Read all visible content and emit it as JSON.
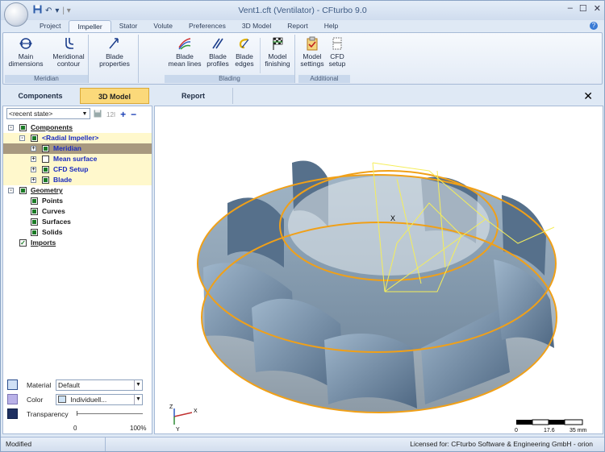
{
  "titlebar": {
    "title": "Vent1.cft (Ventilator) - CFturbo 9.0",
    "quick_access": [
      "save-icon",
      "undo-icon"
    ]
  },
  "menu_tabs": [
    "Project",
    "Impeller",
    "Stator",
    "Volute",
    "Preferences",
    "3D Model",
    "Report",
    "Help"
  ],
  "active_menu_tab": "Impeller",
  "ribbon": {
    "groups": [
      {
        "label": "Meridian",
        "buttons": [
          {
            "label": "Main\ndimensions",
            "icon": "main-dimensions-icon"
          },
          {
            "label": "Meridional\ncontour",
            "icon": "meridional-contour-icon"
          }
        ]
      },
      {
        "label": "",
        "buttons": [
          {
            "label": "Blade\nproperties",
            "icon": "blade-properties-icon"
          }
        ]
      },
      {
        "label": "Blading",
        "buttons": [
          {
            "label": "Blade\nmean lines",
            "icon": "blade-mean-lines-icon"
          },
          {
            "label": "Blade\nprofiles",
            "icon": "blade-profiles-icon"
          },
          {
            "label": "Blade\nedges",
            "icon": "blade-edges-icon"
          },
          {
            "label": "Model\nfinishing",
            "icon": "model-finishing-icon"
          }
        ]
      },
      {
        "label": "Additional",
        "buttons": [
          {
            "label": "Model\nsettings",
            "icon": "model-settings-icon"
          },
          {
            "label": "CFD\nsetup",
            "icon": "cfd-setup-icon"
          }
        ]
      }
    ]
  },
  "panel_tabs": [
    "Components",
    "3D Model",
    "Report"
  ],
  "active_panel_tab": "3D Model",
  "state": {
    "select_value": "<recent state>",
    "buttons": [
      "save-state-icon",
      "rename-icon",
      "+",
      "−"
    ]
  },
  "tree": [
    {
      "label": "Components",
      "level": 0,
      "checked": true,
      "expand": "-",
      "style": "u"
    },
    {
      "label": "<Radial Impeller>",
      "level": 1,
      "checked": true,
      "expand": "-",
      "style": "blue",
      "bg": "yellow"
    },
    {
      "label": "Meridian",
      "level": 2,
      "checked": true,
      "expand": "+",
      "style": "blue",
      "bg": "sel"
    },
    {
      "label": "Mean surface",
      "level": 2,
      "checked": false,
      "expand": "+",
      "style": "blue",
      "bg": "yellow"
    },
    {
      "label": "CFD Setup",
      "level": 2,
      "checked": true,
      "expand": "+",
      "style": "blue",
      "bg": "yellow"
    },
    {
      "label": "Blade",
      "level": 2,
      "checked": true,
      "expand": "+",
      "style": "blue",
      "bg": "yellow"
    },
    {
      "label": "Geometry",
      "level": 0,
      "checked": true,
      "expand": "-",
      "style": "u"
    },
    {
      "label": "Points",
      "level": 1,
      "checked": true,
      "expand": "",
      "style": ""
    },
    {
      "label": "Curves",
      "level": 1,
      "checked": true,
      "expand": "",
      "style": ""
    },
    {
      "label": "Surfaces",
      "level": 1,
      "checked": true,
      "expand": "",
      "style": ""
    },
    {
      "label": "Solids",
      "level": 1,
      "checked": true,
      "expand": "",
      "style": ""
    },
    {
      "label": "Imports",
      "level": 0,
      "checked": "tick",
      "expand": "",
      "style": "u"
    }
  ],
  "properties": {
    "material_label": "Material",
    "material_value": "Default",
    "color_label": "Color",
    "color_value": "Individuell...",
    "color_swatch": "#cfe4f7",
    "transparency_label": "Transparency",
    "transparency_min": "0",
    "transparency_max": "100%",
    "transparency_value": 0
  },
  "viewport": {
    "axis_labels": [
      "X",
      "Y",
      "Z"
    ],
    "cursor_label": "X",
    "scale_labels": [
      "0",
      "17.6",
      "35 mm"
    ],
    "colors": {
      "shroud": "#7f96ab",
      "blade": "#5d7892",
      "edge": "#f0a018",
      "mesh": "#f5ee5a"
    }
  },
  "status": {
    "modified": "Modified",
    "license": "Licensed for: CFturbo Software & Engineering GmbH - orion"
  }
}
